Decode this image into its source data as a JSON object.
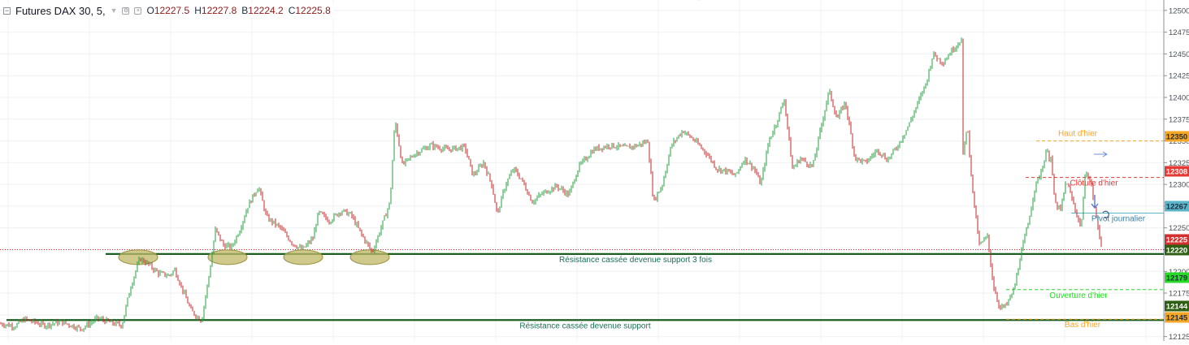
{
  "legend": {
    "collapse_icon": "minus-square-icon",
    "symbol": "Futures DAX 30, 5,",
    "dropdown_icon": "chevron-down-icon",
    "settings_icon": "gear-icon",
    "close_icon": "close-icon",
    "open_label": "O",
    "open_value": "12227.5",
    "high_label": "H",
    "high_value": "12227.8",
    "low_label": "B",
    "low_value": "12224.2",
    "close_label": "C",
    "close_value": "12225.8"
  },
  "colors": {
    "up": "#26a040",
    "down": "#c62828",
    "grid": "#eef0f3",
    "support": "#1b5e20"
  },
  "chart_data": {
    "type": "candlestick",
    "timeframe": "5",
    "ylim": [
      12120,
      12512
    ],
    "yticks": [
      12125,
      12150,
      12175,
      12200,
      12225,
      12250,
      12275,
      12300,
      12325,
      12350,
      12375,
      12400,
      12425,
      12450,
      12475,
      12500
    ],
    "price_path": [
      [
        0,
        12140
      ],
      [
        18,
        12137
      ],
      [
        30,
        12145
      ],
      [
        55,
        12138
      ],
      [
        75,
        12142
      ],
      [
        100,
        12134
      ],
      [
        120,
        12146
      ],
      [
        140,
        12140
      ],
      [
        150,
        12138
      ],
      [
        160,
        12180
      ],
      [
        172,
        12215
      ],
      [
        180,
        12210
      ],
      [
        195,
        12198
      ],
      [
        208,
        12195
      ],
      [
        215,
        12202
      ],
      [
        222,
        12185
      ],
      [
        235,
        12155
      ],
      [
        248,
        12143
      ],
      [
        258,
        12200
      ],
      [
        265,
        12248
      ],
      [
        275,
        12230
      ],
      [
        285,
        12228
      ],
      [
        295,
        12248
      ],
      [
        305,
        12275
      ],
      [
        318,
        12298
      ],
      [
        328,
        12262
      ],
      [
        345,
        12250
      ],
      [
        360,
        12232
      ],
      [
        372,
        12225
      ],
      [
        385,
        12238
      ],
      [
        392,
        12268
      ],
      [
        405,
        12258
      ],
      [
        420,
        12270
      ],
      [
        432,
        12265
      ],
      [
        445,
        12242
      ],
      [
        458,
        12222
      ],
      [
        468,
        12248
      ],
      [
        480,
        12280
      ],
      [
        486,
        12375
      ],
      [
        495,
        12322
      ],
      [
        510,
        12335
      ],
      [
        530,
        12345
      ],
      [
        550,
        12340
      ],
      [
        572,
        12343
      ],
      [
        582,
        12310
      ],
      [
        595,
        12325
      ],
      [
        605,
        12300
      ],
      [
        612,
        12265
      ],
      [
        622,
        12300
      ],
      [
        632,
        12318
      ],
      [
        642,
        12305
      ],
      [
        655,
        12280
      ],
      [
        668,
        12290
      ],
      [
        685,
        12298
      ],
      [
        700,
        12288
      ],
      [
        712,
        12320
      ],
      [
        730,
        12340
      ],
      [
        750,
        12345
      ],
      [
        770,
        12342
      ],
      [
        785,
        12345
      ],
      [
        797,
        12350
      ],
      [
        804,
        12280
      ],
      [
        815,
        12300
      ],
      [
        826,
        12345
      ],
      [
        840,
        12362
      ],
      [
        855,
        12350
      ],
      [
        870,
        12335
      ],
      [
        882,
        12318
      ],
      [
        895,
        12315
      ],
      [
        905,
        12310
      ],
      [
        916,
        12330
      ],
      [
        928,
        12318
      ],
      [
        936,
        12300
      ],
      [
        946,
        12350
      ],
      [
        955,
        12370
      ],
      [
        965,
        12398
      ],
      [
        975,
        12318
      ],
      [
        985,
        12330
      ],
      [
        1000,
        12320
      ],
      [
        1010,
        12365
      ],
      [
        1020,
        12408
      ],
      [
        1030,
        12375
      ],
      [
        1040,
        12395
      ],
      [
        1052,
        12330
      ],
      [
        1065,
        12325
      ],
      [
        1080,
        12340
      ],
      [
        1092,
        12328
      ],
      [
        1105,
        12345
      ],
      [
        1118,
        12368
      ],
      [
        1130,
        12395
      ],
      [
        1140,
        12418
      ],
      [
        1148,
        12450
      ],
      [
        1160,
        12440
      ],
      [
        1172,
        12455
      ],
      [
        1183,
        12467
      ],
      [
        1185,
        12332
      ],
      [
        1190,
        12370
      ],
      [
        1197,
        12290
      ],
      [
        1205,
        12230
      ],
      [
        1215,
        12240
      ],
      [
        1222,
        12185
      ],
      [
        1230,
        12158
      ],
      [
        1238,
        12160
      ],
      [
        1248,
        12180
      ],
      [
        1255,
        12215
      ],
      [
        1265,
        12255
      ],
      [
        1273,
        12295
      ],
      [
        1282,
        12318
      ],
      [
        1290,
        12345
      ],
      [
        1293,
        12330
      ],
      [
        1298,
        12278
      ],
      [
        1305,
        12270
      ],
      [
        1312,
        12305
      ],
      [
        1320,
        12280
      ],
      [
        1330,
        12250
      ],
      [
        1336,
        12318
      ],
      [
        1343,
        12298
      ],
      [
        1350,
        12255
      ],
      [
        1356,
        12226
      ]
    ],
    "levels": [
      {
        "name": "Haut d'hier",
        "price": 12350,
        "badge_color": "#f5a623",
        "label_color": "#f5a623",
        "style": "dashed"
      },
      {
        "name": "Clôture d'hier",
        "price": 12308,
        "badge_color": "#e53935",
        "label_color": "#e53935",
        "style": "dashed"
      },
      {
        "name": "Pivot journalier",
        "price": 12267,
        "badge_color": "#5bb5c9",
        "label_color": "#3e7fa0",
        "style": "solid"
      },
      {
        "name": "",
        "price": 12225,
        "badge_color": "#d32f2f",
        "label_color": "#d32f2f",
        "style": "dotted"
      },
      {
        "name": "Résistance cassée devenue support 3 fois",
        "price": 12220,
        "badge_color": "#2e5f12",
        "label_color": "#1b6e5a",
        "style": "solid"
      },
      {
        "name": "Ouverture d'hier",
        "price": 12179,
        "badge_color": "#26d926",
        "label_color": "#26d926",
        "style": "dashed"
      },
      {
        "name": "Résistance cassée devenue support",
        "price": 12144,
        "badge_color": "#2e5f12",
        "label_color": "#1b6e5a",
        "style": "solid"
      },
      {
        "name": "Bas d'hier",
        "price": 12145,
        "badge_color": "#f5a623",
        "label_color": "#f5a623",
        "style": "dashed"
      }
    ],
    "support_touches": [
      170,
      280,
      373,
      455
    ],
    "support_touch_fill": "#bfb865"
  }
}
